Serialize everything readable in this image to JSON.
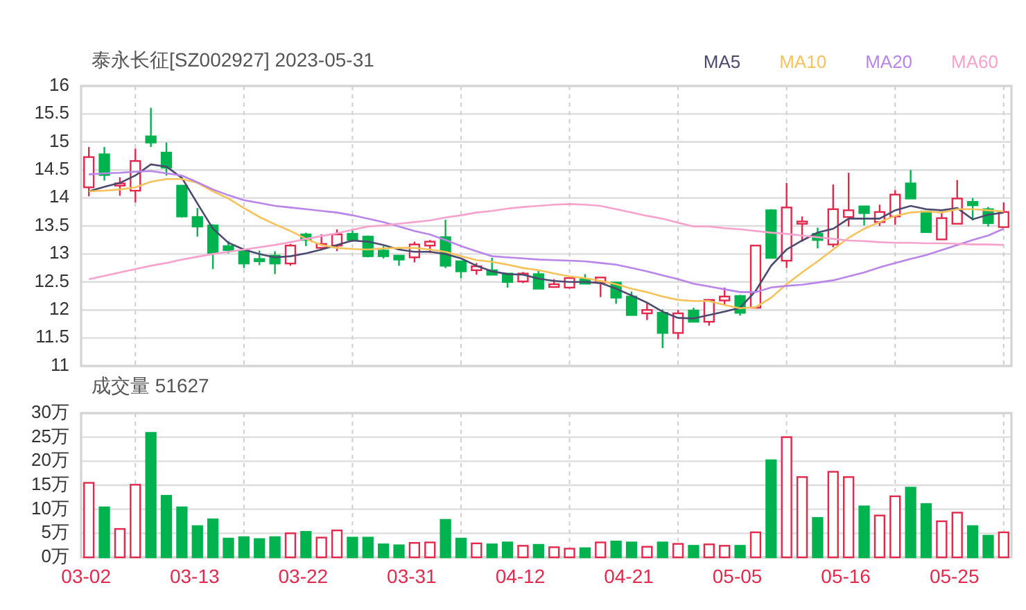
{
  "title": "泰永长征[SZ002927] 2023-05-31",
  "price_chart": {
    "chart_data": {
      "type": "candlestick",
      "grid": true,
      "categories": [
        null,
        null,
        null,
        null,
        null,
        null,
        null,
        null,
        null,
        null,
        null,
        null,
        null,
        null,
        null,
        null,
        null,
        null,
        null,
        null,
        null,
        null,
        null,
        null,
        null,
        null,
        null,
        null,
        null,
        null,
        null,
        null,
        null,
        null,
        null,
        null,
        null,
        null,
        null,
        null,
        null,
        null,
        null,
        null,
        null,
        null,
        null,
        null,
        null,
        null,
        null,
        null,
        null,
        null,
        null,
        null,
        null,
        null,
        null,
        null
      ],
      "ylim": [
        11,
        16
      ],
      "yticks": [
        11,
        11.5,
        12,
        12.5,
        13,
        13.5,
        14,
        14.5,
        15,
        15.5,
        16
      ],
      "ohlc": [
        [
          14.19,
          14.91,
          14.03,
          14.73
        ],
        [
          14.78,
          14.91,
          14.31,
          14.41
        ],
        [
          14.22,
          14.37,
          14.04,
          14.26
        ],
        [
          14.13,
          14.88,
          13.92,
          14.66
        ],
        [
          15.1,
          15.61,
          14.91,
          14.99
        ],
        [
          14.81,
          14.99,
          14.4,
          14.54
        ],
        [
          14.22,
          14.22,
          13.65,
          13.67
        ],
        [
          13.66,
          13.82,
          13.31,
          13.49
        ],
        [
          13.51,
          13.53,
          12.73,
          13.02
        ],
        [
          13.14,
          13.23,
          13.01,
          13.07
        ],
        [
          13.06,
          13.09,
          12.75,
          12.83
        ],
        [
          12.91,
          13.06,
          12.8,
          12.87
        ],
        [
          12.97,
          13.05,
          12.64,
          12.83
        ],
        [
          12.83,
          13.18,
          12.79,
          13.15
        ],
        [
          13.35,
          13.38,
          13.14,
          13.25
        ],
        [
          13.11,
          13.35,
          13.08,
          13.18
        ],
        [
          13.15,
          13.44,
          13.05,
          13.35
        ],
        [
          13.36,
          13.43,
          13.22,
          13.25
        ],
        [
          13.31,
          13.33,
          12.94,
          12.96
        ],
        [
          13.06,
          13.14,
          12.92,
          12.96
        ],
        [
          12.97,
          12.97,
          12.79,
          12.9
        ],
        [
          12.94,
          13.22,
          12.85,
          13.17
        ],
        [
          13.15,
          13.25,
          13.02,
          13.22
        ],
        [
          13.3,
          13.61,
          12.75,
          12.79
        ],
        [
          12.87,
          12.87,
          12.57,
          12.69
        ],
        [
          12.71,
          12.84,
          12.63,
          12.78
        ],
        [
          12.71,
          12.93,
          12.63,
          12.63
        ],
        [
          12.65,
          12.65,
          12.4,
          12.5
        ],
        [
          12.51,
          12.68,
          12.48,
          12.65
        ],
        [
          12.64,
          12.71,
          12.38,
          12.38
        ],
        [
          12.41,
          12.55,
          12.41,
          12.46
        ],
        [
          12.4,
          12.57,
          12.38,
          12.57
        ],
        [
          12.55,
          12.64,
          12.46,
          12.47
        ],
        [
          12.49,
          12.58,
          12.23,
          12.58
        ],
        [
          12.49,
          12.49,
          12.11,
          12.22
        ],
        [
          12.24,
          12.33,
          11.91,
          11.91
        ],
        [
          11.94,
          12.13,
          11.82,
          12.0
        ],
        [
          11.95,
          12.01,
          11.32,
          11.59
        ],
        [
          11.59,
          12.0,
          11.48,
          11.94
        ],
        [
          11.99,
          12.04,
          11.79,
          11.79
        ],
        [
          11.79,
          12.18,
          11.72,
          12.18
        ],
        [
          12.17,
          12.4,
          12.09,
          12.24
        ],
        [
          12.25,
          12.27,
          11.9,
          11.95
        ],
        [
          12.04,
          13.15,
          12.04,
          13.15
        ],
        [
          13.78,
          13.8,
          12.92,
          12.93
        ],
        [
          12.88,
          14.27,
          12.75,
          13.83
        ],
        [
          13.54,
          13.67,
          13.22,
          13.58
        ],
        [
          13.36,
          13.47,
          13.1,
          13.25
        ],
        [
          13.17,
          14.24,
          13.12,
          13.8
        ],
        [
          13.66,
          14.45,
          13.49,
          13.78
        ],
        [
          13.85,
          13.86,
          13.51,
          13.73
        ],
        [
          13.57,
          13.88,
          13.5,
          13.75
        ],
        [
          13.67,
          14.14,
          13.52,
          14.06
        ],
        [
          14.26,
          14.5,
          13.99,
          13.99
        ],
        [
          13.76,
          13.76,
          13.39,
          13.39
        ],
        [
          13.26,
          13.74,
          13.26,
          13.64
        ],
        [
          13.54,
          14.32,
          13.54,
          13.99
        ],
        [
          13.93,
          14.0,
          13.6,
          13.87
        ],
        [
          13.8,
          13.84,
          13.49,
          13.55
        ],
        [
          13.48,
          13.92,
          13.48,
          13.75
        ]
      ]
    },
    "moving_averages": {
      "chart_data": {
        "type": "line",
        "ylim": [
          11,
          16
        ],
        "series": [
          {
            "name": "MA5",
            "color": "#4b4a6e",
            "values": [
              14.12,
              14.2,
              14.27,
              14.4,
              14.6,
              14.56,
              14.36,
              13.9,
              13.45,
              13.2,
              13.08,
              13.0,
              12.94,
              12.96,
              13.01,
              13.08,
              13.16,
              13.24,
              13.22,
              13.16,
              13.08,
              13.04,
              13.04,
              13.0,
              12.92,
              12.79,
              12.69,
              12.64,
              12.63,
              12.56,
              12.52,
              12.5,
              12.5,
              12.48,
              12.38,
              12.26,
              12.13,
              11.97,
              11.86,
              11.85,
              11.91,
              11.97,
              12.04,
              12.34,
              12.79,
              13.08,
              13.24,
              13.38,
              13.45,
              13.63,
              13.63,
              13.63,
              13.78,
              13.86,
              13.8,
              13.78,
              13.82,
              13.62,
              13.7,
              13.74
            ]
          },
          {
            "name": "MA10",
            "color": "#f7c25a",
            "values": [
              14.12,
              14.13,
              14.15,
              14.19,
              14.29,
              14.34,
              14.34,
              14.27,
              14.12,
              13.99,
              13.82,
              13.66,
              13.53,
              13.41,
              13.27,
              13.16,
              13.11,
              13.09,
              13.08,
              13.1,
              13.11,
              13.11,
              13.08,
              13.04,
              12.96,
              12.89,
              12.86,
              12.81,
              12.75,
              12.71,
              12.65,
              12.6,
              12.57,
              12.52,
              12.46,
              12.38,
              12.32,
              12.24,
              12.18,
              12.16,
              12.16,
              12.09,
              12.03,
              12.05,
              12.22,
              12.46,
              12.67,
              12.87,
              13.08,
              13.29,
              13.45,
              13.57,
              13.68,
              13.74,
              13.76,
              13.74,
              13.8,
              13.8,
              13.78,
              13.76
            ]
          },
          {
            "name": "MA20",
            "color": "#b985e8",
            "values": [
              14.42,
              14.44,
              14.45,
              14.47,
              14.48,
              14.44,
              14.4,
              14.28,
              14.15,
              14.05,
              13.96,
              13.91,
              13.86,
              13.83,
              13.8,
              13.77,
              13.74,
              13.69,
              13.63,
              13.57,
              13.49,
              13.41,
              13.35,
              13.25,
              13.14,
              13.05,
              12.96,
              12.94,
              12.92,
              12.9,
              12.89,
              12.88,
              12.87,
              12.84,
              12.81,
              12.75,
              12.69,
              12.62,
              12.55,
              12.47,
              12.42,
              12.37,
              12.32,
              12.32,
              12.4,
              12.43,
              12.45,
              12.49,
              12.53,
              12.6,
              12.67,
              12.76,
              12.84,
              12.91,
              12.98,
              13.07,
              13.16,
              13.25,
              13.33,
              13.45
            ]
          },
          {
            "name": "MA60",
            "color": "#f7a1cc",
            "values": [
              12.55,
              12.61,
              12.67,
              12.73,
              12.79,
              12.84,
              12.9,
              12.95,
              13.0,
              13.04,
              13.08,
              13.12,
              13.16,
              13.21,
              13.27,
              13.32,
              13.37,
              13.43,
              13.49,
              13.51,
              13.54,
              13.57,
              13.6,
              13.65,
              13.69,
              13.74,
              13.77,
              13.81,
              13.84,
              13.86,
              13.88,
              13.89,
              13.88,
              13.86,
              13.8,
              13.74,
              13.68,
              13.63,
              13.56,
              13.49,
              13.49,
              13.46,
              13.44,
              13.41,
              13.38,
              13.36,
              13.33,
              13.3,
              13.27,
              13.24,
              13.23,
              13.21,
              13.2,
              13.2,
              13.19,
              13.19,
              13.18,
              13.17,
              13.17,
              13.16
            ]
          }
        ]
      }
    }
  },
  "volume_chart": {
    "chart_data": {
      "type": "bar",
      "grid": true,
      "title": "成交量 51627",
      "categories": [
        "03-02",
        null,
        null,
        null,
        null,
        null,
        null,
        "03-13",
        null,
        null,
        null,
        null,
        null,
        null,
        "03-22",
        null,
        null,
        null,
        null,
        null,
        null,
        "03-31",
        null,
        null,
        null,
        null,
        null,
        null,
        "04-12",
        null,
        null,
        null,
        null,
        null,
        null,
        "04-21",
        null,
        null,
        null,
        null,
        null,
        null,
        "05-05",
        null,
        null,
        null,
        null,
        null,
        null,
        "05-16",
        null,
        null,
        null,
        null,
        null,
        null,
        "05-25",
        null,
        null,
        null
      ],
      "ylim": [
        0,
        30
      ],
      "yticks": [
        {
          "value": 0,
          "label": "0万"
        },
        {
          "value": 5,
          "label": "5万"
        },
        {
          "value": 10,
          "label": "10万"
        },
        {
          "value": 15,
          "label": "15万"
        },
        {
          "value": 20,
          "label": "20万"
        },
        {
          "value": 25,
          "label": "25万"
        },
        {
          "value": 30,
          "label": "30万"
        }
      ],
      "values": [
        15.5,
        10.4,
        5.9,
        15.1,
        25.9,
        12.8,
        10.4,
        6.5,
        7.9,
        3.9,
        4.2,
        3.8,
        4.2,
        5.0,
        5.3,
        4.1,
        5.6,
        4.1,
        4.1,
        2.7,
        2.5,
        3.0,
        3.1,
        7.8,
        3.9,
        2.9,
        2.7,
        3.1,
        2.4,
        2.6,
        2.1,
        1.8,
        1.9,
        3.1,
        3.3,
        3.1,
        2.2,
        3.1,
        2.8,
        2.4,
        2.7,
        2.4,
        2.4,
        5.2,
        20.2,
        25.0,
        16.7,
        8.2,
        17.8,
        16.7,
        10.6,
        8.7,
        12.7,
        14.5,
        11.1,
        7.5,
        9.3,
        6.5,
        4.5,
        5.2
      ]
    }
  }
}
